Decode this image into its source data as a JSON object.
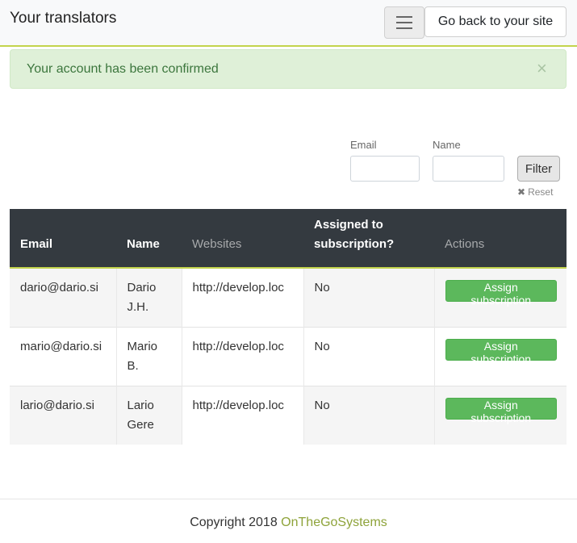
{
  "navbar": {
    "brand": "Your translators",
    "back_button": "Go back to your site"
  },
  "alert": {
    "message": "Your account has been confirmed",
    "close": "×"
  },
  "filters": {
    "email_label": "Email",
    "name_label": "Name",
    "email_value": "",
    "name_value": "",
    "filter_button": "Filter",
    "reset_icon": "x-icon",
    "reset_label": "Reset"
  },
  "table": {
    "headers": {
      "email": "Email",
      "name": "Name",
      "websites": "Websites",
      "assigned": "Assigned to subscription?",
      "actions": "Actions"
    },
    "rows": [
      {
        "email": "dario@dario.si",
        "name": "Dario J.H.",
        "website": "http://develop.loc",
        "assigned": "No",
        "action": "Assign subscription"
      },
      {
        "email": "mario@dario.si",
        "name": "Mario B.",
        "website": "http://develop.loc",
        "assigned": "No",
        "action": "Assign subscription"
      },
      {
        "email": "lario@dario.si",
        "name": "Lario Gere",
        "website": "http://develop.loc",
        "assigned": "No",
        "action": "Assign subscription"
      }
    ]
  },
  "footer": {
    "copyright": "Copyright 2018",
    "company": "OnTheGoSystems"
  },
  "colors": {
    "accent": "#c3d44c",
    "header_bg": "#343a40",
    "success": "#5cb85c",
    "alert_bg": "#dff0d8",
    "link": "#8ea33a"
  }
}
